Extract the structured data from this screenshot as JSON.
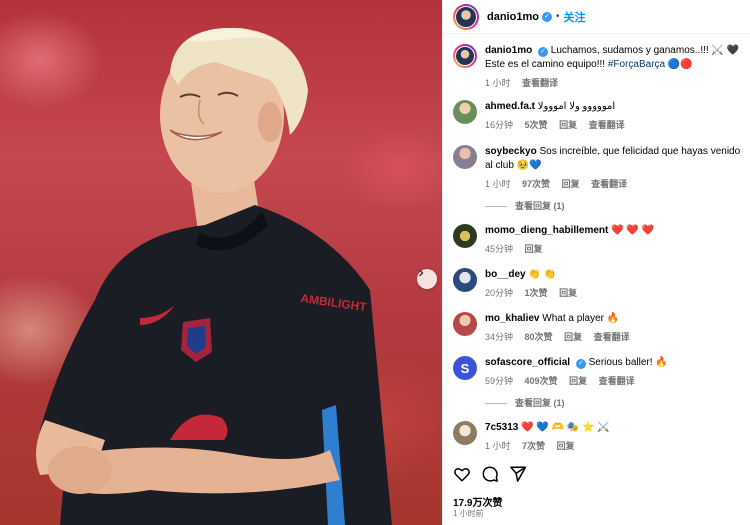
{
  "header": {
    "username": "danio1mo",
    "separator": "•",
    "follow_label": "关注"
  },
  "caption": {
    "username": "danio1mo",
    "text": "Luchamos, sudamos y ganamos..!!! ⚔️ 🖤 Este es el camino equipo!!!",
    "hashtag": "#ForçaBarça",
    "emoji_tail": "🔵🔴",
    "time": "1 小时",
    "translate": "查看翻译"
  },
  "comments": [
    {
      "username": "ahmed.fa.t",
      "text": "امووووو ولا امووولا",
      "time": "16分钟",
      "likes": "5次赞",
      "reply": "回复",
      "translate": "查看翻译"
    },
    {
      "username": "soybeckyo",
      "text": "Sos increíble, que felicidad que hayas venido al club 🥹💙",
      "time": "1 小时",
      "likes": "97次赞",
      "reply": "回复",
      "translate": "查看翻译",
      "more_replies": "查看回复 (1)"
    },
    {
      "username": "momo_dieng_habillement",
      "text": "❤️ ❤️ ❤️",
      "time": "45分钟",
      "reply": "回复"
    },
    {
      "username": "bo__dey",
      "text": "👏 👏",
      "time": "20分钟",
      "likes": "1次赞",
      "reply": "回复"
    },
    {
      "username": "mo_khaliev",
      "text": "What a player 🔥",
      "time": "34分钟",
      "likes": "80次赞",
      "reply": "回复",
      "translate": "查看翻译"
    },
    {
      "username": "sofascore_official",
      "text": "Serious baller! 🔥",
      "time": "59分钟",
      "likes": "409次赞",
      "reply": "回复",
      "translate": "查看翻译",
      "more_replies": "查看回复 (1)"
    },
    {
      "username": "7c5313",
      "text": "❤️ 💙 🫶 🎭 ⭐ ⚔️",
      "time": "1 小时",
      "likes": "7次赞",
      "reply": "回复"
    }
  ],
  "likes_count": "17.9万次赞",
  "post_time": "1 小时前",
  "jersey_sponsor": "AMBILIGHT",
  "icons": [
    "heart-icon",
    "comment-icon",
    "share-icon",
    "chevron-right-icon",
    "verified-icon"
  ],
  "colors": {
    "accent": "#0095f6",
    "verified": "#3897f0",
    "jersey": "#1a1d24",
    "photo_bg": "#b8343c"
  }
}
